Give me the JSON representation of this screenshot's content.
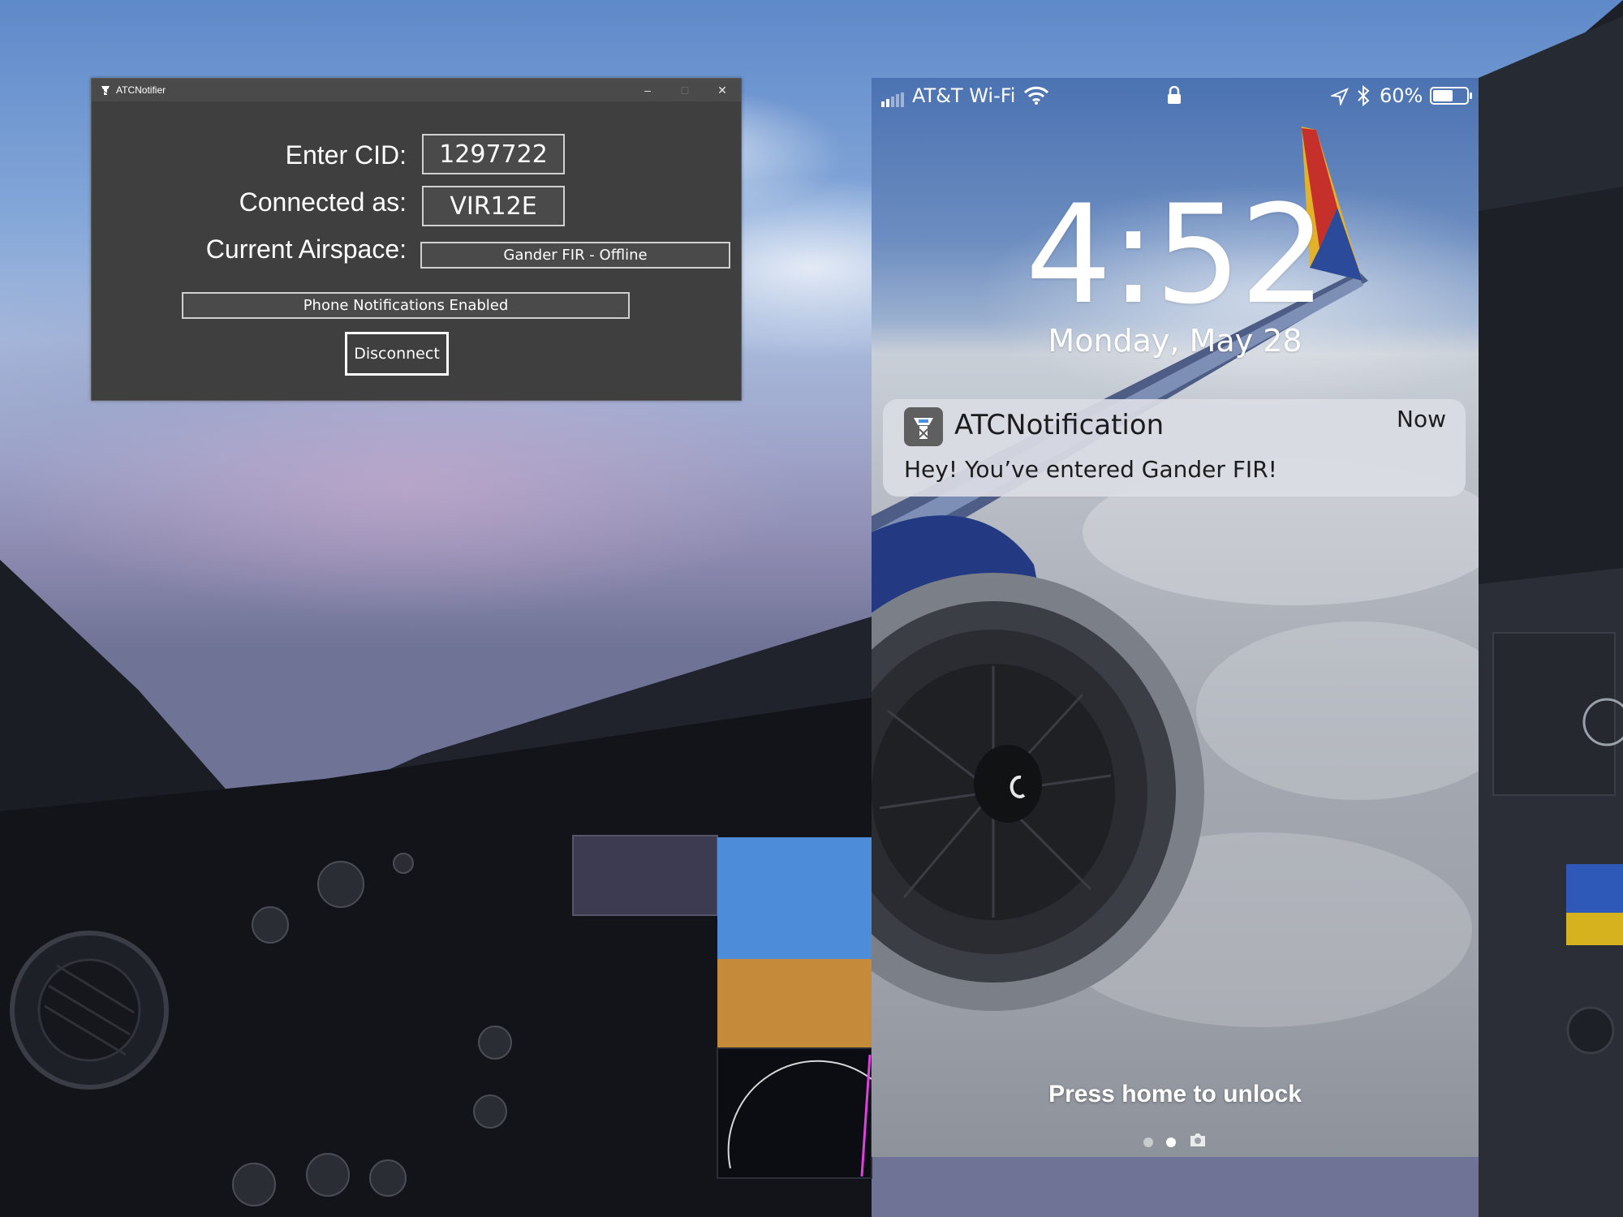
{
  "window": {
    "title": "ATCNotifier",
    "controls": {
      "minimize": "–",
      "maximize": "□",
      "close": "✕"
    }
  },
  "form": {
    "cid_label": "Enter CID:",
    "cid_value": "1297722",
    "callsign_label": "Connected as:",
    "callsign_value": "VIR12E",
    "airspace_label": "Current Airspace:",
    "airspace_value": "Gander FIR - Offline",
    "notifications_status": "Phone Notifications Enabled",
    "disconnect_label": "Disconnect"
  },
  "phone": {
    "status_bar": {
      "carrier": "AT&T Wi-Fi",
      "battery": "60%",
      "battery_level": 0.6,
      "icons": [
        "signal-bars-icon",
        "wifi-icon",
        "lock-icon",
        "location-arrow-icon",
        "bluetooth-icon",
        "battery-icon"
      ]
    },
    "time": "4:52",
    "date": "Monday, May 28",
    "notification": {
      "app": "ATCNotification",
      "time": "Now",
      "message": "Hey! You’ve entered Gander FIR!",
      "icon": "control-tower-icon"
    },
    "unlock_hint": "Press home to unlock",
    "page_dots": 2,
    "active_page": 2,
    "icons": [
      "camera-icon"
    ]
  },
  "colors": {
    "window_bg": "#3f3f3f",
    "notification_bg": "#dadde4",
    "sky": "#6c8dc0"
  }
}
